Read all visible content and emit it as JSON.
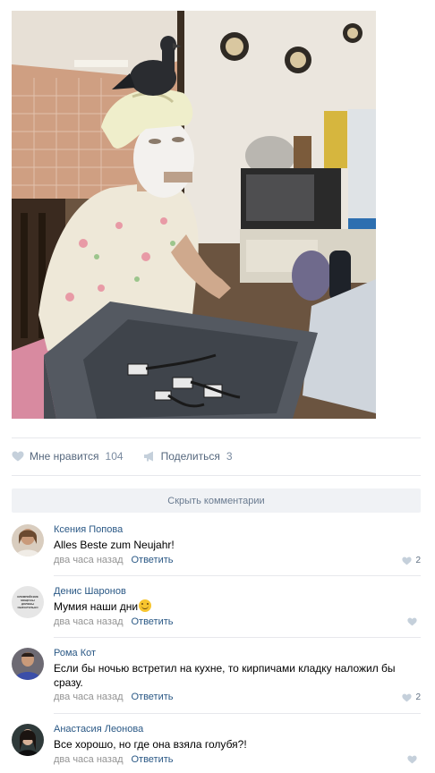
{
  "post": {
    "photo_icon": "photo-icon",
    "likes_label": "Мне нравится",
    "likes_count": "104",
    "share_label": "Поделиться",
    "share_count": "3"
  },
  "comments_toggle": "Скрыть комментарии",
  "comments": [
    {
      "author": "Ксения Попова",
      "text": "Alles Beste zum Neujahr!",
      "time": "два часа назад",
      "reply": "Ответить",
      "likes": "2"
    },
    {
      "author": "Денис Шаронов",
      "text": "Мумия наши дни",
      "avatar_text": "ОЛИМПИЙСКИЕ ВЕЩИ ВЫ ДОЛЖНЫ ОБЯЗАТЕЛЬНО",
      "time": "два часа назад",
      "reply": "Ответить",
      "likes": ""
    },
    {
      "author": "Рома Кот",
      "text": "Если бы ночью встретил на кухне, то кирпичами кладку наложил бы сразу.",
      "time": "два часа назад",
      "reply": "Ответить",
      "likes": "2"
    },
    {
      "author": "Анастасия Леонова",
      "text": "Все хорошо, но где она взяла голубя?!",
      "time": "два часа назад",
      "reply": "Ответить",
      "likes": ""
    }
  ],
  "colors": {
    "link": "#2a5885",
    "muted": "#939393",
    "action": "#55677d",
    "toggle_bg": "#f0f2f5",
    "divider": "#e7e8ec"
  }
}
